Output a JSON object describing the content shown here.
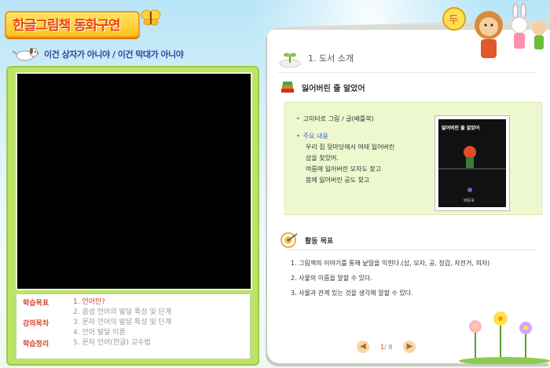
{
  "header": {
    "title": "한글그림책 동화구연",
    "subtitle": "이건 상자가 아니야 / 이건 막대가 아니야"
  },
  "menu": {
    "categories": [
      "학습목표",
      "강의목차",
      "학습정리"
    ],
    "items": [
      {
        "label": "1. 언어란?",
        "active": true
      },
      {
        "label": "2. 음성 언어의 발달 특성 및 단계",
        "active": false
      },
      {
        "label": "3. 문자 언어의 발달 특성 및 단계",
        "active": false
      },
      {
        "label": "4. 언어 발달 이론",
        "active": false
      },
      {
        "label": "5. 문자 언어(한글) 교수법",
        "active": false
      }
    ]
  },
  "section": {
    "title": "1. 도서 소개",
    "book_title": "잃어버린 줄 알았어",
    "author": "고미타로 그림 / 글(베틀북)",
    "summary_label": "주요 내용",
    "summary_lines": [
      "우리 집 뒷마당에서 여태 잃어버린",
      "삽을 찾았어.",
      "여름에 잃어버린 모자도 찾고",
      "봄에 잃어버린 공도 찾고"
    ],
    "cover_title": "잃어버린 줄 알았어",
    "cover_publisher": "베틀북"
  },
  "activity": {
    "title": "활동 목표",
    "goals": [
      "1. 그림책의 이야기를 통해 낱말을 익힌다.(삽, 모자, 공, 장갑, 자전거, 의자)",
      "2. 사물의 이름을 말할 수 있다.",
      "3. 사물과 관계 있는 것을 생각해 말할 수 있다."
    ]
  },
  "pager": {
    "current": "1",
    "total": " / 8"
  },
  "colors": {
    "accent": "#d0442b",
    "panel_green": "#bde36a",
    "link_blue": "#3a5fcb"
  }
}
